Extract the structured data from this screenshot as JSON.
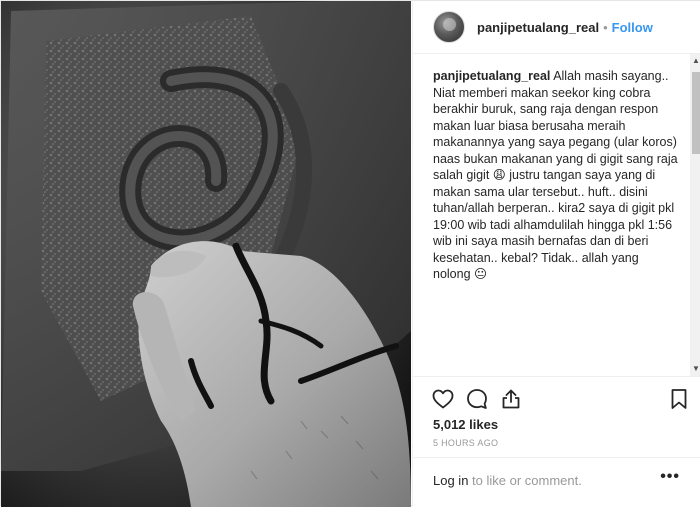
{
  "header": {
    "username": "panjipetualang_real",
    "separator": "•",
    "follow_label": "Follow"
  },
  "caption": {
    "username": "panjipetualang_real",
    "text": " Allah masih sayang..\nNiat memberi makan seekor king cobra berakhir buruk, sang raja dengan respon makan luar biasa berusaha meraih makanannya yang saya pegang (ular koros) naas bukan makanan yang di gigit sang raja salah gigit 😩 justru tangan saya yang di makan sama ular tersebut.. huft.. disini tuhan/allah berperan.. kira2 saya di gigit pkl 19:00 wib tadi alhamdulilah hingga pkl 1:56 wib ini saya masih bernafas dan di beri kesehatan.. kebal? Tidak.. allah yang nolong 😐"
  },
  "actions": {
    "icons": [
      "heart-icon",
      "comment-icon",
      "share-icon",
      "bookmark-icon"
    ],
    "likes": "5,012 likes",
    "timestamp": "5 HOURS AGO"
  },
  "comment_box": {
    "login_label": "Log in",
    "rest_text": " to like or comment.",
    "more_label": "•••"
  },
  "photo": {
    "description_icon": "photo"
  }
}
